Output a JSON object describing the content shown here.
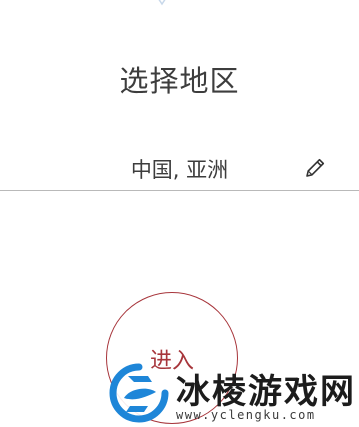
{
  "header": {
    "title": "选择地区"
  },
  "region": {
    "value": "中国, 亚洲",
    "edit_icon": "pencil-icon"
  },
  "action": {
    "enter_label": "进入",
    "accent_color": "#a7353b"
  },
  "watermark": {
    "logo_icon": "yclengku-logo",
    "title": "冰棱游戏网",
    "url": "www.yclengku.com",
    "logo_color": "#1e86d8"
  }
}
